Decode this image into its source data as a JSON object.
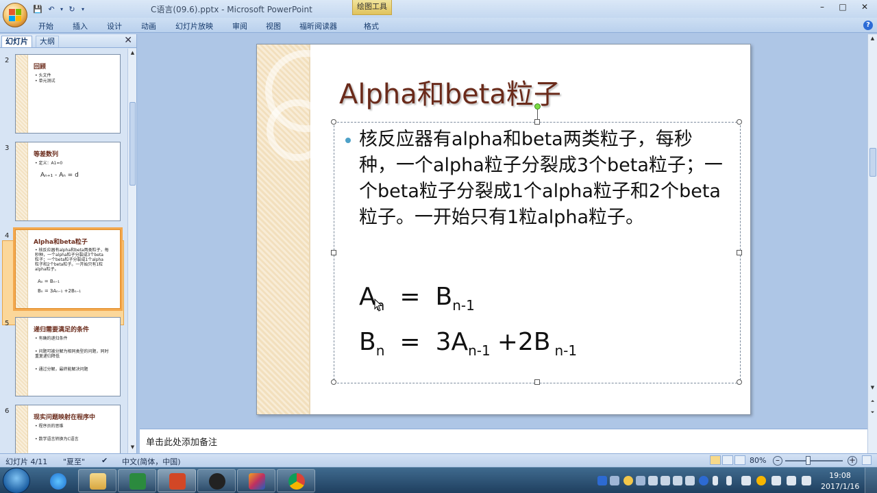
{
  "titlebar": {
    "document_title": "C语言(09.6).pptx - Microsoft PowerPoint",
    "contextual_tab": "绘图工具",
    "minimize": "–",
    "restore": "□",
    "close": "✕"
  },
  "ribbon": {
    "tabs": [
      "开始",
      "插入",
      "设计",
      "动画",
      "幻灯片放映",
      "审阅",
      "视图",
      "福昕阅读器",
      "格式"
    ],
    "help": "?"
  },
  "left_panel": {
    "tab_slides": "幻灯片",
    "tab_outline": "大纲",
    "close": "✕",
    "thumbnails": [
      {
        "num": "2",
        "title": "回顾",
        "bullets": [
          "• 头文件",
          "• 单元测试"
        ]
      },
      {
        "num": "3",
        "title": "等差数列",
        "bullets": [
          "• 定义：A1=0",
          "Aₙ₊₁ - Aₙ  = d"
        ]
      },
      {
        "num": "4",
        "title": "Alpha和beta粒子",
        "bullets": [
          "• 核反应器有alpha和beta两类粒子，每",
          "  秒种，一个alpha粒子分裂成3个beta",
          "  粒子；一个beta粒子分裂成1个alpha",
          "  粒子和2个beta粒子。一开始只有1粒",
          "  alpha粒子。",
          "Aₙ  =  Bₙ₋₁",
          "Bₙ  =  3Aₙ₋₁ +2Bₙ₋₁"
        ]
      },
      {
        "num": "5",
        "title": "递归需要满足的条件",
        "bullets": [
          "• 有确的递归条件",
          "• 问题可被分解为相同类型的问题，同时",
          "  重复递归降低",
          "• 通过分解，最终能解决问题"
        ]
      },
      {
        "num": "6",
        "title": "现实问题映射在程序中",
        "bullets": [
          "• 程序员的思维",
          "• 数学语言转换为C语言"
        ]
      }
    ]
  },
  "slide": {
    "title": "Alpha和beta粒子",
    "bullet": "核反应器有alpha和beta两类粒子，每秒种，一个alpha粒子分裂成3个beta粒子；一个beta粒子分裂成1个alpha粒子和2个beta粒子。一开始只有1粒alpha粒子。",
    "formula1": {
      "lhs": "A",
      "lhs_sub": "n",
      "eq": "=",
      "rhs": "B",
      "rhs_sub": "n-1"
    },
    "formula2": {
      "lhs": "B",
      "lhs_sub": "n",
      "eq": "=",
      "rhs1": "3A",
      "rhs1_sub": "n-1",
      "plus": "+2B",
      "rhs2_sub": "n-1"
    }
  },
  "notes": {
    "placeholder": "单击此处添加备注"
  },
  "statusbar": {
    "slide_info": "幻灯片 4/11",
    "theme": "\"夏至\"",
    "language": "中文(简体，中国)",
    "zoom": "80%",
    "zoom_minus": "–",
    "zoom_plus": "+"
  },
  "taskbar": {
    "time": "19:08",
    "date": "2017/1/16",
    "apps": [
      "internet-explorer",
      "file-explorer",
      "excel",
      "powerpoint",
      "obs",
      "app-swirl",
      "chrome"
    ]
  }
}
